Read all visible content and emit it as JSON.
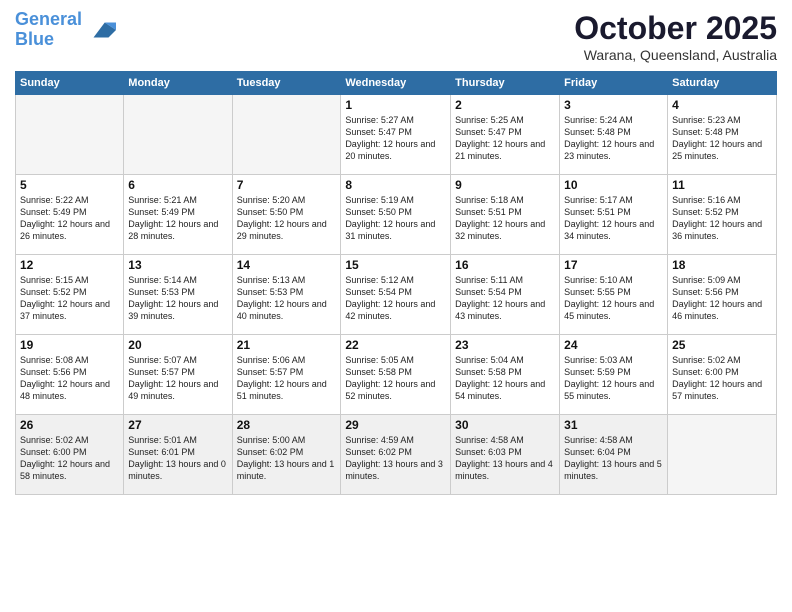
{
  "header": {
    "logo_line1": "General",
    "logo_line2": "Blue",
    "month": "October 2025",
    "location": "Warana, Queensland, Australia"
  },
  "weekdays": [
    "Sunday",
    "Monday",
    "Tuesday",
    "Wednesday",
    "Thursday",
    "Friday",
    "Saturday"
  ],
  "weeks": [
    [
      {
        "day": "",
        "info": ""
      },
      {
        "day": "",
        "info": ""
      },
      {
        "day": "",
        "info": ""
      },
      {
        "day": "1",
        "info": "Sunrise: 5:27 AM\nSunset: 5:47 PM\nDaylight: 12 hours\nand 20 minutes."
      },
      {
        "day": "2",
        "info": "Sunrise: 5:25 AM\nSunset: 5:47 PM\nDaylight: 12 hours\nand 21 minutes."
      },
      {
        "day": "3",
        "info": "Sunrise: 5:24 AM\nSunset: 5:48 PM\nDaylight: 12 hours\nand 23 minutes."
      },
      {
        "day": "4",
        "info": "Sunrise: 5:23 AM\nSunset: 5:48 PM\nDaylight: 12 hours\nand 25 minutes."
      }
    ],
    [
      {
        "day": "5",
        "info": "Sunrise: 5:22 AM\nSunset: 5:49 PM\nDaylight: 12 hours\nand 26 minutes."
      },
      {
        "day": "6",
        "info": "Sunrise: 5:21 AM\nSunset: 5:49 PM\nDaylight: 12 hours\nand 28 minutes."
      },
      {
        "day": "7",
        "info": "Sunrise: 5:20 AM\nSunset: 5:50 PM\nDaylight: 12 hours\nand 29 minutes."
      },
      {
        "day": "8",
        "info": "Sunrise: 5:19 AM\nSunset: 5:50 PM\nDaylight: 12 hours\nand 31 minutes."
      },
      {
        "day": "9",
        "info": "Sunrise: 5:18 AM\nSunset: 5:51 PM\nDaylight: 12 hours\nand 32 minutes."
      },
      {
        "day": "10",
        "info": "Sunrise: 5:17 AM\nSunset: 5:51 PM\nDaylight: 12 hours\nand 34 minutes."
      },
      {
        "day": "11",
        "info": "Sunrise: 5:16 AM\nSunset: 5:52 PM\nDaylight: 12 hours\nand 36 minutes."
      }
    ],
    [
      {
        "day": "12",
        "info": "Sunrise: 5:15 AM\nSunset: 5:52 PM\nDaylight: 12 hours\nand 37 minutes."
      },
      {
        "day": "13",
        "info": "Sunrise: 5:14 AM\nSunset: 5:53 PM\nDaylight: 12 hours\nand 39 minutes."
      },
      {
        "day": "14",
        "info": "Sunrise: 5:13 AM\nSunset: 5:53 PM\nDaylight: 12 hours\nand 40 minutes."
      },
      {
        "day": "15",
        "info": "Sunrise: 5:12 AM\nSunset: 5:54 PM\nDaylight: 12 hours\nand 42 minutes."
      },
      {
        "day": "16",
        "info": "Sunrise: 5:11 AM\nSunset: 5:54 PM\nDaylight: 12 hours\nand 43 minutes."
      },
      {
        "day": "17",
        "info": "Sunrise: 5:10 AM\nSunset: 5:55 PM\nDaylight: 12 hours\nand 45 minutes."
      },
      {
        "day": "18",
        "info": "Sunrise: 5:09 AM\nSunset: 5:56 PM\nDaylight: 12 hours\nand 46 minutes."
      }
    ],
    [
      {
        "day": "19",
        "info": "Sunrise: 5:08 AM\nSunset: 5:56 PM\nDaylight: 12 hours\nand 48 minutes."
      },
      {
        "day": "20",
        "info": "Sunrise: 5:07 AM\nSunset: 5:57 PM\nDaylight: 12 hours\nand 49 minutes."
      },
      {
        "day": "21",
        "info": "Sunrise: 5:06 AM\nSunset: 5:57 PM\nDaylight: 12 hours\nand 51 minutes."
      },
      {
        "day": "22",
        "info": "Sunrise: 5:05 AM\nSunset: 5:58 PM\nDaylight: 12 hours\nand 52 minutes."
      },
      {
        "day": "23",
        "info": "Sunrise: 5:04 AM\nSunset: 5:58 PM\nDaylight: 12 hours\nand 54 minutes."
      },
      {
        "day": "24",
        "info": "Sunrise: 5:03 AM\nSunset: 5:59 PM\nDaylight: 12 hours\nand 55 minutes."
      },
      {
        "day": "25",
        "info": "Sunrise: 5:02 AM\nSunset: 6:00 PM\nDaylight: 12 hours\nand 57 minutes."
      }
    ],
    [
      {
        "day": "26",
        "info": "Sunrise: 5:02 AM\nSunset: 6:00 PM\nDaylight: 12 hours\nand 58 minutes."
      },
      {
        "day": "27",
        "info": "Sunrise: 5:01 AM\nSunset: 6:01 PM\nDaylight: 13 hours\nand 0 minutes."
      },
      {
        "day": "28",
        "info": "Sunrise: 5:00 AM\nSunset: 6:02 PM\nDaylight: 13 hours\nand 1 minute."
      },
      {
        "day": "29",
        "info": "Sunrise: 4:59 AM\nSunset: 6:02 PM\nDaylight: 13 hours\nand 3 minutes."
      },
      {
        "day": "30",
        "info": "Sunrise: 4:58 AM\nSunset: 6:03 PM\nDaylight: 13 hours\nand 4 minutes."
      },
      {
        "day": "31",
        "info": "Sunrise: 4:58 AM\nSunset: 6:04 PM\nDaylight: 13 hours\nand 5 minutes."
      },
      {
        "day": "",
        "info": ""
      }
    ]
  ]
}
